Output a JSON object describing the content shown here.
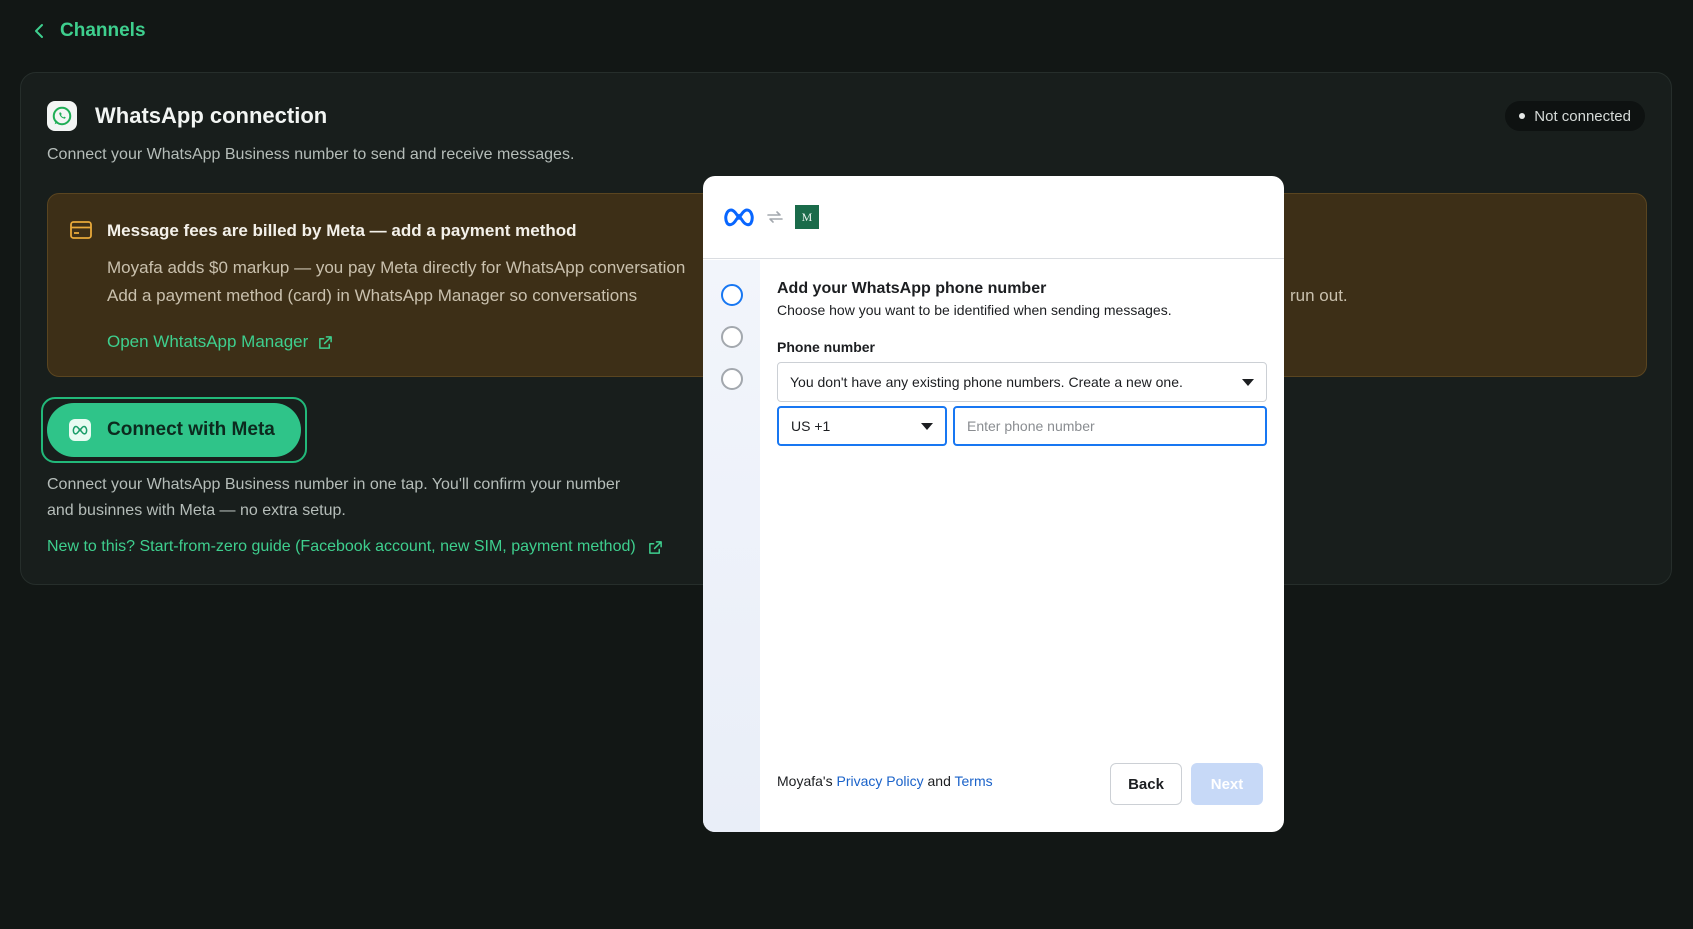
{
  "nav": {
    "back_label": "Channels"
  },
  "card": {
    "title": "WhatsApp connection",
    "subtitle": "Connect your WhatsApp Business number to send and receive messages.",
    "status": "Not connected"
  },
  "notice": {
    "title": "Message fees are billed by Meta — add a payment method",
    "line1": "Moyafa adds $0 markup — you pay Meta directly for WhatsApp conversation",
    "line2": "Add a payment method (card) in WhatsApp Manager so conversations",
    "line2_tail": "run out.",
    "link_label": "Open WhtatsApp Manager"
  },
  "connect": {
    "button_label": "Connect with Meta",
    "help_text": "Connect your WhatsApp Business number in one tap. You'll confirm your number and businnes with Meta — no extra setup.",
    "guide_link": "New to this? Start-from-zero guide (Facebook account, new SIM, payment method)"
  },
  "modal": {
    "badge_letter": "M",
    "title": "Add your WhatsApp phone number",
    "subtitle": "Choose how you want to be identified when sending messages.",
    "phone_label": "Phone number",
    "existing_select_value": "You don't have any existing phone numbers. Create a new one.",
    "country_value": "US +1",
    "phone_placeholder": "Enter phone number",
    "footer_prefix": "Moyafa's",
    "privacy_link": "Privacy Policy",
    "footer_and": "and",
    "terms_link": "Terms",
    "back_label": "Back",
    "next_label": "Next"
  },
  "colors": {
    "accent": "#3ecf8e",
    "meta_blue": "#1877f2",
    "notice_bg": "#3d2f17"
  },
  "icons": {
    "back": "chevron-left-icon",
    "whatsapp": "whatsapp-icon",
    "card": "credit-card-icon",
    "external": "external-link-icon",
    "meta": "meta-logo-icon",
    "sync": "sync-icon"
  }
}
